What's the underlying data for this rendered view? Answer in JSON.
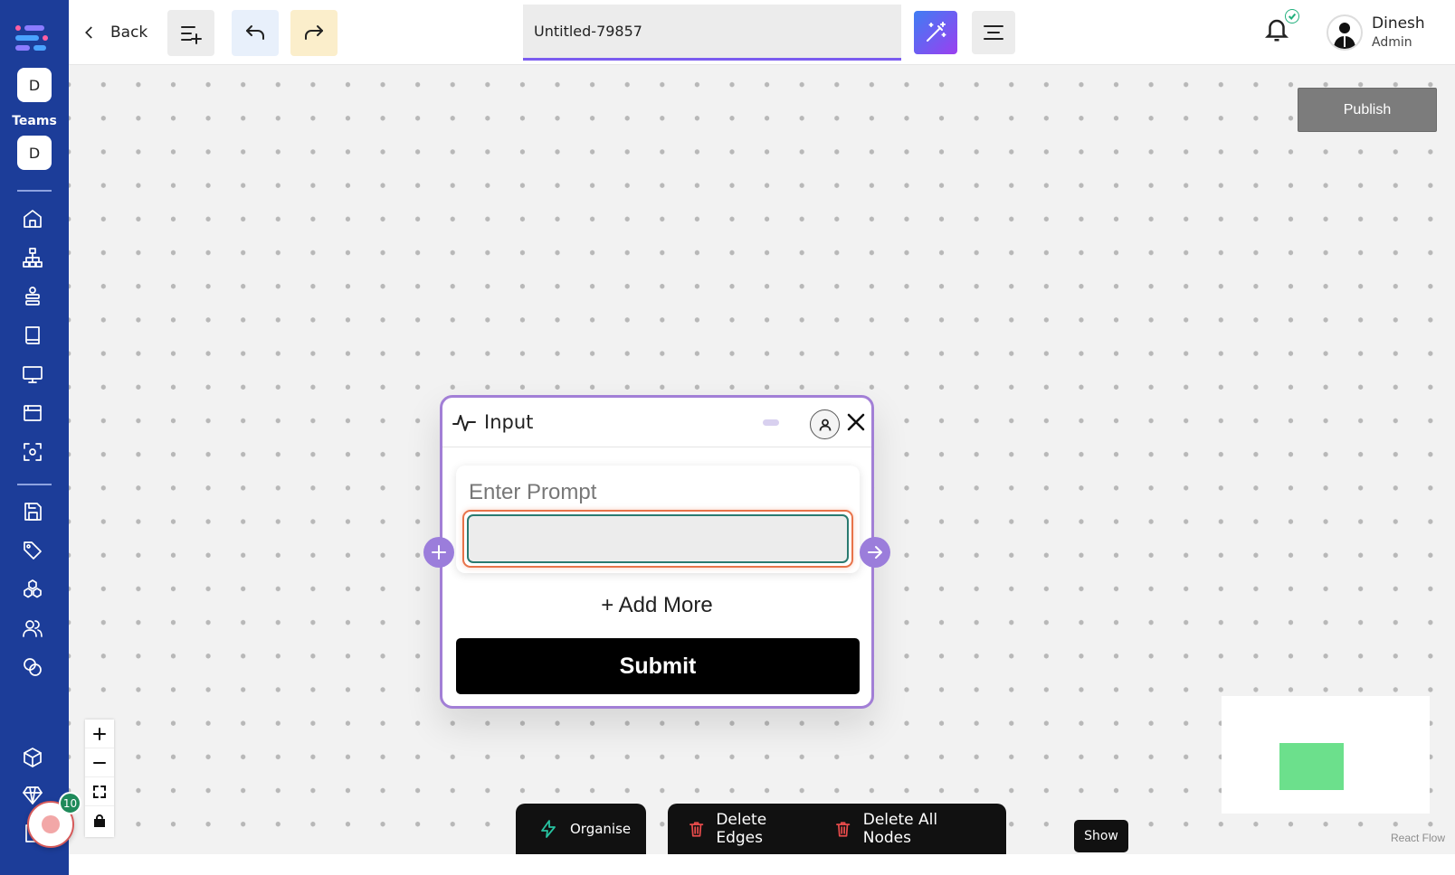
{
  "sidebar": {
    "teams": [
      {
        "initial": "D"
      },
      {
        "initial": "D"
      }
    ],
    "teams_label": "Teams",
    "nav_icons": [
      "home-icon",
      "hierarchy-icon",
      "stack-icon",
      "book-icon",
      "monitor-icon",
      "browser-window-icon",
      "scan-icon",
      "save-icon",
      "tag-icon",
      "cubes-icon",
      "users-icon",
      "coins-icon"
    ],
    "bottom_icons": [
      "package-icon",
      "diamond-icon",
      "document-icon"
    ],
    "accent": "#1c3d99"
  },
  "topbar": {
    "back_label": "Back",
    "document_title": "Untitled-79857",
    "user": {
      "name": "Dinesh",
      "role": "Admin"
    }
  },
  "canvas": {
    "publish_label": "Publish",
    "node": {
      "title": "Input",
      "prompt_label": "Enter Prompt",
      "prompt_value": "",
      "add_more_label": "+ Add More",
      "submit_label": "Submit"
    },
    "toolbar": {
      "organise_label": "Organise",
      "delete_edges_label": "Delete Edges",
      "delete_all_nodes_label": "Delete All Nodes",
      "show_label": "Show"
    },
    "attribution": "React Flow"
  },
  "recorder": {
    "badge_count": "10"
  }
}
